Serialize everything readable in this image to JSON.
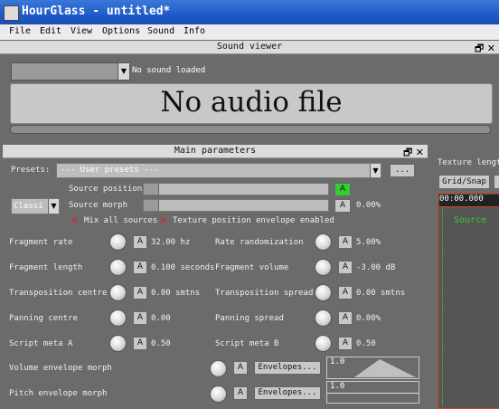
{
  "window": {
    "title": "HourGlass - untitled*"
  },
  "menu": [
    "File",
    "Edit",
    "View",
    "Options",
    "Sound",
    "Info"
  ],
  "sound_viewer": {
    "title": "Sound viewer",
    "combo_value": "",
    "status": "No sound loaded",
    "placeholder": "No audio file"
  },
  "main": {
    "title": "Main parameters",
    "presets_label": "Presets:",
    "presets_value": "--- User presets ---",
    "presets_button": "...",
    "mode_value": "Classi",
    "source_position_label": "Source position",
    "source_position_a": "A",
    "source_morph_label": "Source morph",
    "source_morph_a": "A",
    "source_morph_value": "0.00%",
    "mix_all": "Mix all sources",
    "tex_env": "Texture position envelope enabled",
    "a_label": "A",
    "rows": [
      {
        "l_label": "Fragment rate",
        "l_value": "32.00 hz",
        "r_label": "Rate randomization",
        "r_value": "5.00%"
      },
      {
        "l_label": "Fragment length",
        "l_value": "0.100 seconds",
        "r_label": "Fragment volume",
        "r_value": "-3.00 dB"
      },
      {
        "l_label": "Transposition centre",
        "l_value": "0.00 smtns",
        "r_label": "Transposition spread",
        "r_value": "0.00 smtns"
      },
      {
        "l_label": "Panning centre",
        "l_value": "0.00",
        "r_label": "Panning spread",
        "r_value": "0.00%"
      },
      {
        "l_label": "Script meta A",
        "l_value": "0.50",
        "r_label": "Script meta B",
        "r_value": "0.50"
      }
    ],
    "volume_env_label": "Volume envelope morph",
    "pitch_env_label": "Pitch envelope morph",
    "envelopes_button": "Envelopes...",
    "volume_env_value": "1.0",
    "pitch_env_value": "1.0"
  },
  "texture": {
    "label": "Texture lengt",
    "grid_snap": "Grid/Snap",
    "time": "00:00.000",
    "source": "Source"
  },
  "colors": {
    "title_bar": "#1f5bc8",
    "accent_green": "#33cc33",
    "canvas_border": "#cc4422"
  }
}
